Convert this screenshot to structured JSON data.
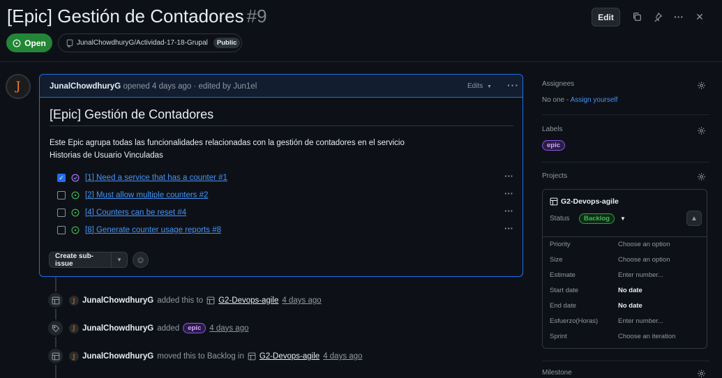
{
  "issue": {
    "title": "[Epic] Gestión de Contadores",
    "number": "#9",
    "state": "Open",
    "repo": "JunalChowdhuryG/Actividad-17-18-Grupal",
    "visibility": "Public"
  },
  "header": {
    "edit_label": "Edit"
  },
  "comment": {
    "author": "JunalChowdhuryG",
    "meta": "opened 4 days ago · edited by Jun1el",
    "edits_label": "Edits",
    "body_title": "[Epic] Gestión de Contadores",
    "description": "Este Epic agrupa todas las funcionalidades relacionadas con la gestión de contadores en el servicio Historias de Usuario Vinculadas",
    "tasks": [
      {
        "label": "[1] Need a service that has a counter #1",
        "checked": true,
        "state": "closed"
      },
      {
        "label": "[2] Must allow multiple counters #2",
        "checked": false,
        "state": "open"
      },
      {
        "label": "[4] Counters can be reset #4",
        "checked": false,
        "state": "open"
      },
      {
        "label": "[8] Generate counter usage reports #8",
        "checked": false,
        "state": "open"
      }
    ],
    "create_sub_issue_label": "Create sub-issue"
  },
  "timeline": [
    {
      "actor": "JunalChowdhuryG",
      "action": "added this to",
      "target": "G2-Devops-agile",
      "time": "4 days ago"
    },
    {
      "actor": "JunalChowdhuryG",
      "action": "added",
      "label": "epic",
      "time": "4 days ago"
    },
    {
      "actor": "JunalChowdhuryG",
      "action": "moved this to Backlog in",
      "target": "G2-Devops-agile",
      "time": "4 days ago"
    }
  ],
  "sidebar": {
    "assignees": {
      "title": "Assignees",
      "value": "No one -",
      "assign_link": "Assign yourself"
    },
    "labels": {
      "title": "Labels",
      "items": [
        "epic"
      ]
    },
    "projects": {
      "title": "Projects",
      "project_name": "G2-Devops-agile",
      "status_label": "Status",
      "status_value": "Backlog",
      "fields": [
        {
          "key": "Priority",
          "value": "Choose an option",
          "strong": false
        },
        {
          "key": "Size",
          "value": "Choose an option",
          "strong": false
        },
        {
          "key": "Estimate",
          "value": "Enter number...",
          "strong": false
        },
        {
          "key": "Start date",
          "value": "No date",
          "strong": true
        },
        {
          "key": "End date",
          "value": "No date",
          "strong": true
        },
        {
          "key": "Esfuerzo(Horas)",
          "value": "Enter number...",
          "strong": false
        },
        {
          "key": "Sprint",
          "value": "Choose an iteration",
          "strong": false
        }
      ]
    },
    "milestone": {
      "title": "Milestone"
    }
  },
  "colors": {
    "accent": "#1f6feb",
    "open_green": "#238636",
    "epic_purple": "#8957e5",
    "link_blue": "#4493f8"
  }
}
